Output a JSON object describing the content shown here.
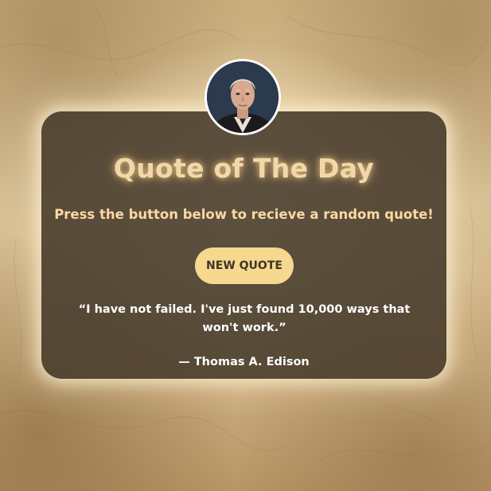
{
  "page": {
    "title": "Quote of The Day",
    "subtitle": "Press the button below to recieve a random quote!",
    "button_label": "NEW QUOTE"
  },
  "quote": {
    "text": "“I have not failed. I've just found 10,000 ways that won't work.”",
    "author": "— Thomas A. Edison"
  },
  "colors": {
    "card": "#4a3e2f",
    "title": "#f2d8a8",
    "subtitle": "#fcd9a3",
    "button": "#f6d88e",
    "button_text": "#3f3426",
    "quote_text": "#ffffff"
  },
  "icons": {
    "avatar": "author-portrait"
  }
}
